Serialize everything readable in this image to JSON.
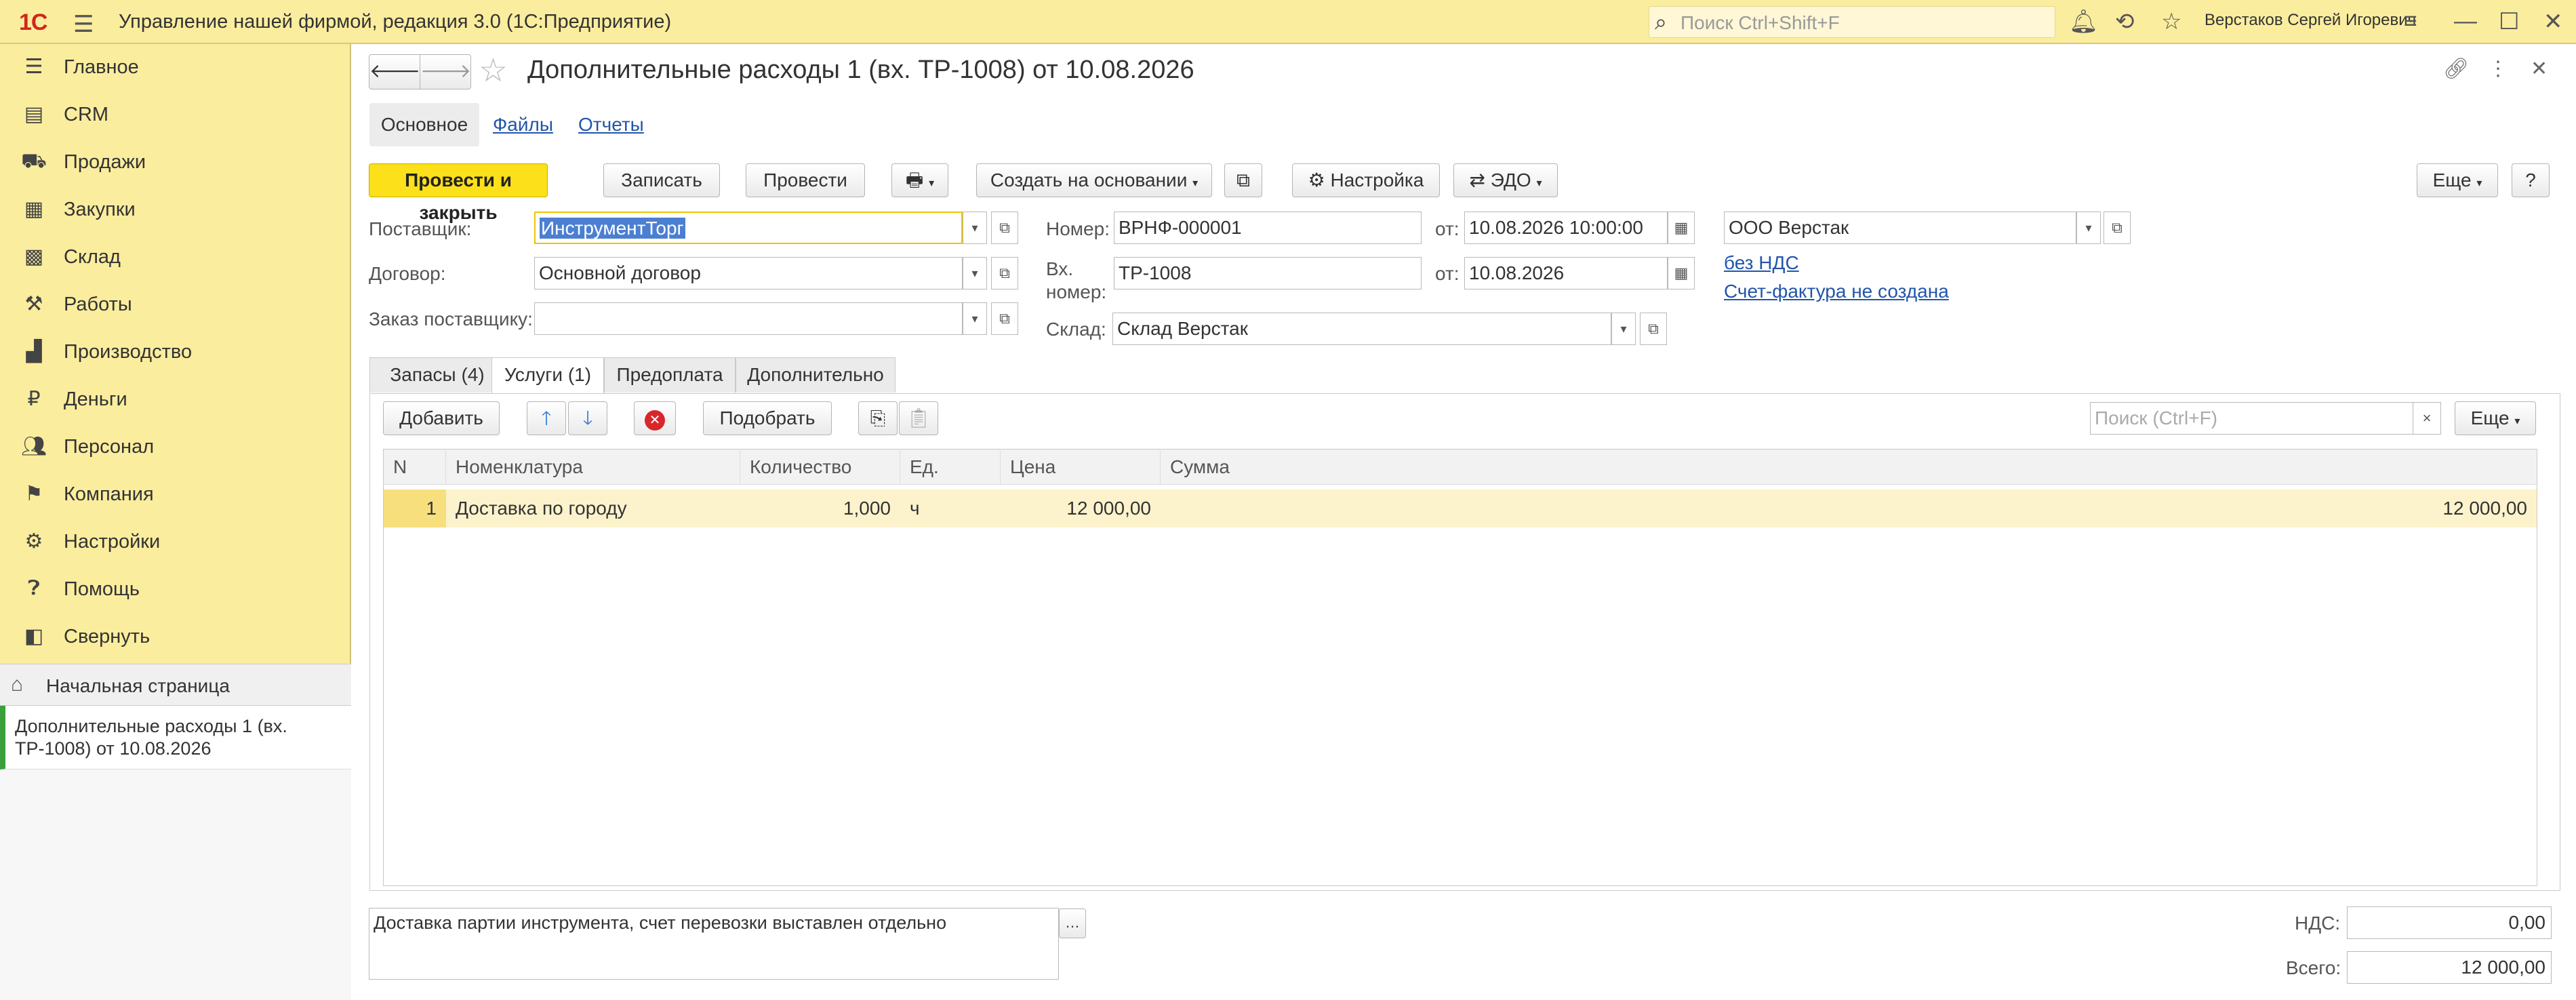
{
  "app": {
    "title": "Управление нашей фирмой, редакция 3.0  (1С:Предприятие)",
    "logo": "1С",
    "search_placeholder": "Поиск Ctrl+Shift+F",
    "user": "Верстаков Сергей Игоревич"
  },
  "sidebar": {
    "items": [
      {
        "label": "Главное",
        "icon": "menu-lines-icon"
      },
      {
        "label": "CRM",
        "icon": "contacts-icon"
      },
      {
        "label": "Продажи",
        "icon": "basket-icon"
      },
      {
        "label": "Закупки",
        "icon": "purchases-icon"
      },
      {
        "label": "Склад",
        "icon": "warehouse-icon"
      },
      {
        "label": "Работы",
        "icon": "tools-icon"
      },
      {
        "label": "Производство",
        "icon": "factory-icon"
      },
      {
        "label": "Деньги",
        "icon": "money-icon"
      },
      {
        "label": "Персонал",
        "icon": "people-icon"
      },
      {
        "label": "Компания",
        "icon": "flag-icon"
      },
      {
        "label": "Настройки",
        "icon": "gear-icon"
      },
      {
        "label": "Помощь",
        "icon": "help-icon"
      },
      {
        "label": "Свернуть",
        "icon": "collapse-icon"
      }
    ],
    "home": "Начальная страница",
    "open_tab": "Дополнительные расходы 1 (вх. ТР-1008) от 10.08.2026"
  },
  "form": {
    "title": "Дополнительные расходы 1 (вх. ТР-1008) от 10.08.2026",
    "subnav": [
      "Основное",
      "Файлы",
      "Отчеты"
    ],
    "toolbar": {
      "post_close": "Провести и закрыть",
      "save": "Записать",
      "post": "Провести",
      "create_based": "Создать на основании",
      "settings": "Настройка",
      "edo": "ЭДО",
      "more": "Еще",
      "help": "?"
    },
    "fields": {
      "supplier_label": "Поставщик:",
      "supplier_value": "ИнструментТорг",
      "contract_label": "Договор:",
      "contract_value": "Основной договор",
      "order_label": "Заказ поставщику:",
      "order_value": "",
      "number_label": "Номер:",
      "number_value": "ВРНФ-000001",
      "date_label": "от:",
      "date_value": "10.08.2026 10:00:00",
      "inc_number_label_1": "Вх.",
      "inc_number_label_2": "номер:",
      "inc_number_value": "ТР-1008",
      "inc_date_label": "от:",
      "inc_date_value": "10.08.2026",
      "warehouse_label": "Склад:",
      "warehouse_value": "Склад Верстак",
      "company_value": "ООО Верстак",
      "vat_link": "без НДС",
      "invoice_link": "Счет-фактура не создана"
    },
    "tabs": [
      "Запасы (4)",
      "Услуги (1)",
      "Предоплата",
      "Дополнительно"
    ],
    "table_toolbar": {
      "add": "Добавить",
      "pick": "Подобрать",
      "search_placeholder": "Поиск (Ctrl+F)",
      "more": "Еще"
    },
    "table": {
      "columns": [
        "N",
        "Номенклатура",
        "Количество",
        "Ед.",
        "Цена",
        "Сумма"
      ],
      "rows": [
        {
          "n": "1",
          "item": "Доставка по городу",
          "qty": "1,000",
          "unit": "ч",
          "price": "12 000,00",
          "sum": "12 000,00"
        }
      ]
    },
    "comment": "Доставка партии инструмента, счет перевозки выставлен отдельно",
    "totals": {
      "vat_label": "НДС:",
      "vat_value": "0,00",
      "total_label": "Всего:",
      "total_value": "12 000,00"
    }
  }
}
